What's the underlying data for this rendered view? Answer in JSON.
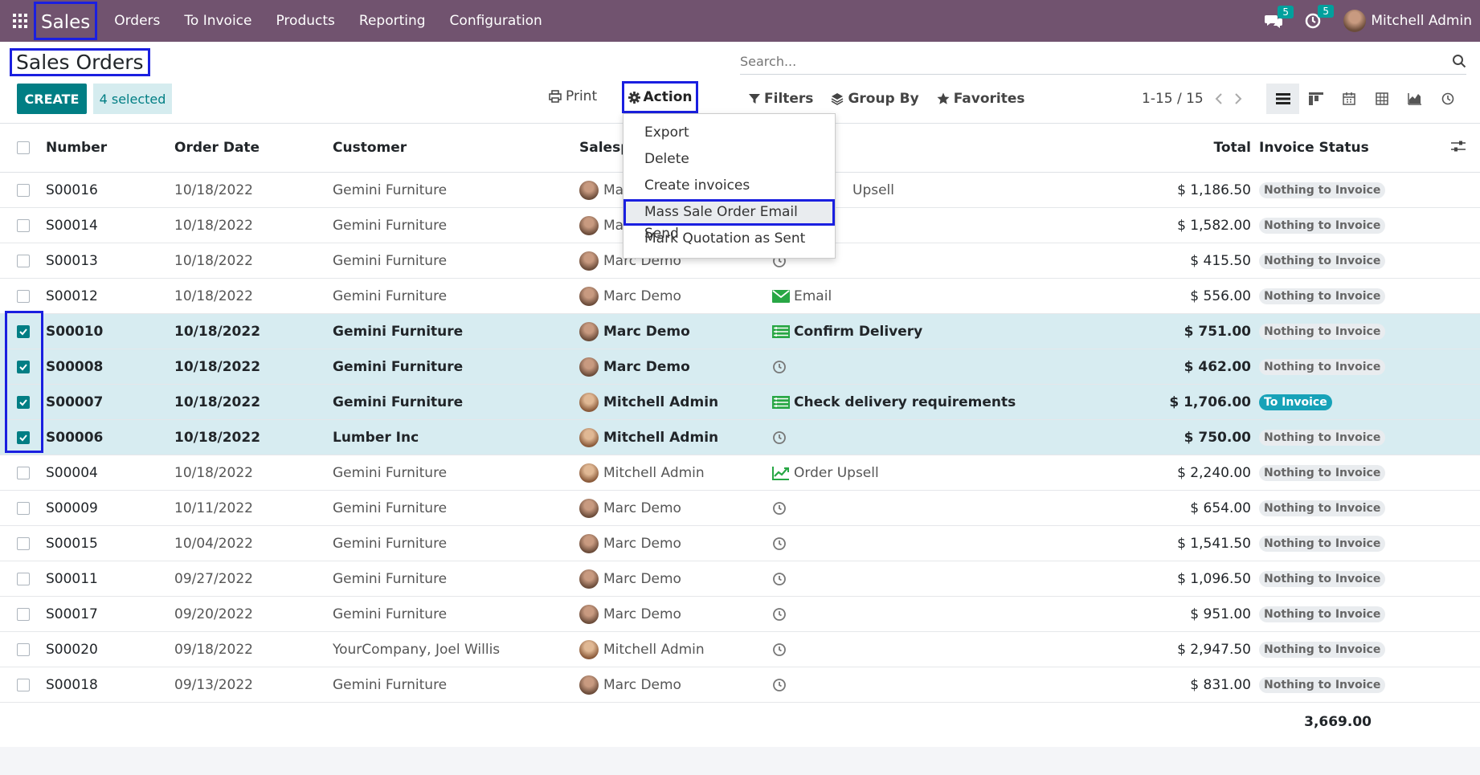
{
  "topbar": {
    "app_name": "Sales",
    "menu": [
      "Orders",
      "To Invoice",
      "Products",
      "Reporting",
      "Configuration"
    ],
    "messages_count": "5",
    "activities_count": "5",
    "user_name": "Mitchell Admin"
  },
  "page": {
    "title": "Sales Orders",
    "search_placeholder": "Search...",
    "create_label": "CREATE",
    "selected_label": "4 selected",
    "print_label": "Print",
    "action_label": "Action",
    "filters_label": "Filters",
    "groupby_label": "Group By",
    "favorites_label": "Favorites",
    "pager": "1-15 / 15"
  },
  "action_menu": [
    "Export",
    "Delete",
    "Create invoices",
    "Mass Sale Order Email Send",
    "Mark Quotation as Sent"
  ],
  "table": {
    "headers": {
      "number": "Number",
      "date": "Order Date",
      "customer": "Customer",
      "salesperson": "Salesp",
      "total": "Total",
      "invoice": "Invoice Status"
    },
    "rows": [
      {
        "number": "S00016",
        "date": "10/18/2022",
        "customer": "Gemini Furniture",
        "sales": "Ma",
        "activity": "Upsell",
        "activity_icon": "none",
        "total": "$ 1,186.50",
        "status": "Nothing to Invoice",
        "selected": false
      },
      {
        "number": "S00014",
        "date": "10/18/2022",
        "customer": "Gemini Furniture",
        "sales": "Ma",
        "activity": "",
        "activity_icon": "none",
        "total": "$ 1,582.00",
        "status": "Nothing to Invoice",
        "selected": false
      },
      {
        "number": "S00013",
        "date": "10/18/2022",
        "customer": "Gemini Furniture",
        "sales": "Marc Demo",
        "activity": "",
        "activity_icon": "clock",
        "total": "$ 415.50",
        "status": "Nothing to Invoice",
        "selected": false
      },
      {
        "number": "S00012",
        "date": "10/18/2022",
        "customer": "Gemini Furniture",
        "sales": "Marc Demo",
        "activity": "Email",
        "activity_icon": "email",
        "total": "$ 556.00",
        "status": "Nothing to Invoice",
        "selected": false
      },
      {
        "number": "S00010",
        "date": "10/18/2022",
        "customer": "Gemini Furniture",
        "sales": "Marc Demo",
        "activity": "Confirm Delivery",
        "activity_icon": "list",
        "total": "$ 751.00",
        "status": "Nothing to Invoice",
        "selected": true
      },
      {
        "number": "S00008",
        "date": "10/18/2022",
        "customer": "Gemini Furniture",
        "sales": "Marc Demo",
        "activity": "",
        "activity_icon": "clock",
        "total": "$ 462.00",
        "status": "Nothing to Invoice",
        "selected": true
      },
      {
        "number": "S00007",
        "date": "10/18/2022",
        "customer": "Gemini Furniture",
        "sales": "Mitchell Admin",
        "activity": "Check delivery requirements",
        "activity_icon": "list",
        "total": "$ 1,706.00",
        "status": "To Invoice",
        "selected": true
      },
      {
        "number": "S00006",
        "date": "10/18/2022",
        "customer": "Lumber Inc",
        "sales": "Mitchell Admin",
        "activity": "",
        "activity_icon": "clock",
        "total": "$ 750.00",
        "status": "Nothing to Invoice",
        "selected": true
      },
      {
        "number": "S00004",
        "date": "10/18/2022",
        "customer": "Gemini Furniture",
        "sales": "Mitchell Admin",
        "activity": "Order Upsell",
        "activity_icon": "chart",
        "total": "$ 2,240.00",
        "status": "Nothing to Invoice",
        "selected": false
      },
      {
        "number": "S00009",
        "date": "10/11/2022",
        "customer": "Gemini Furniture",
        "sales": "Marc Demo",
        "activity": "",
        "activity_icon": "clock",
        "total": "$ 654.00",
        "status": "Nothing to Invoice",
        "selected": false
      },
      {
        "number": "S00015",
        "date": "10/04/2022",
        "customer": "Gemini Furniture",
        "sales": "Marc Demo",
        "activity": "",
        "activity_icon": "clock",
        "total": "$ 1,541.50",
        "status": "Nothing to Invoice",
        "selected": false
      },
      {
        "number": "S00011",
        "date": "09/27/2022",
        "customer": "Gemini Furniture",
        "sales": "Marc Demo",
        "activity": "",
        "activity_icon": "clock",
        "total": "$ 1,096.50",
        "status": "Nothing to Invoice",
        "selected": false
      },
      {
        "number": "S00017",
        "date": "09/20/2022",
        "customer": "Gemini Furniture",
        "sales": "Marc Demo",
        "activity": "",
        "activity_icon": "clock",
        "total": "$ 951.00",
        "status": "Nothing to Invoice",
        "selected": false
      },
      {
        "number": "S00020",
        "date": "09/18/2022",
        "customer": "YourCompany, Joel Willis",
        "sales": "Mitchell Admin",
        "activity": "",
        "activity_icon": "clock",
        "total": "$ 2,947.50",
        "status": "Nothing to Invoice",
        "selected": false
      },
      {
        "number": "S00018",
        "date": "09/13/2022",
        "customer": "Gemini Furniture",
        "sales": "Marc Demo",
        "activity": "",
        "activity_icon": "clock",
        "total": "$ 831.00",
        "status": "Nothing to Invoice",
        "selected": false
      }
    ],
    "sum_total": "3,669.00"
  },
  "colors": {
    "brand": "#71536f",
    "primary": "#017e84",
    "highlight": "#1a1fe0",
    "selected_row": "#d7ecf1"
  }
}
